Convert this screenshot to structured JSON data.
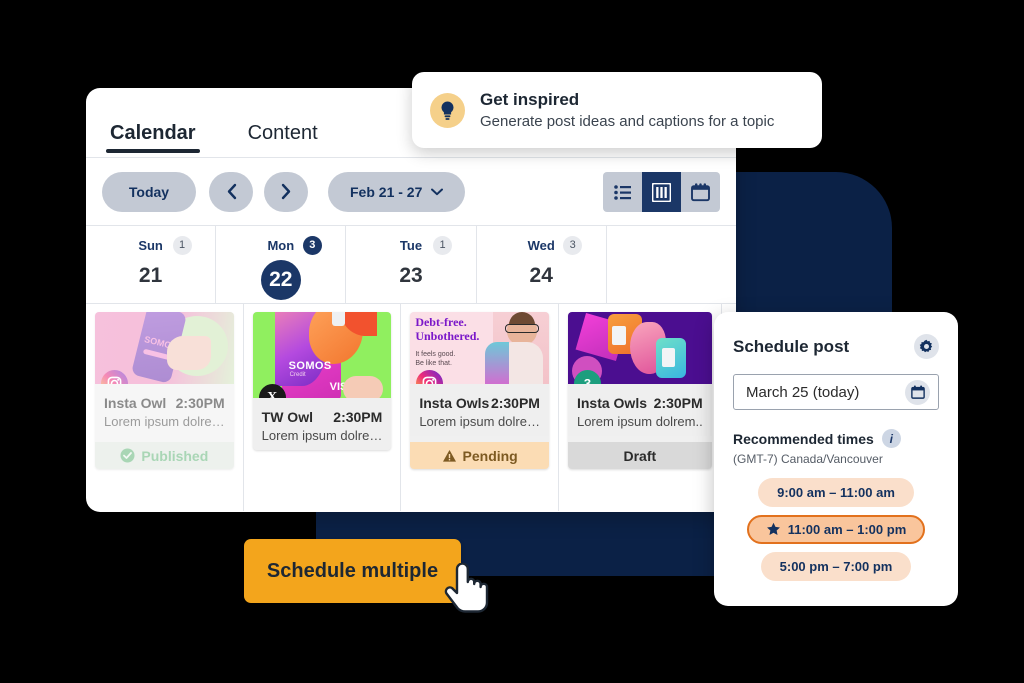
{
  "tabs": [
    {
      "label": "Calendar",
      "active": true
    },
    {
      "label": "Content",
      "active": false
    }
  ],
  "toolbar": {
    "today_label": "Today",
    "prev_icon": "chevron-left-icon",
    "next_icon": "chevron-right-icon",
    "date_range": "Feb 21 - 27",
    "dropdown_icon": "chevron-down-icon",
    "views": [
      {
        "name": "list-view",
        "icon": "list-icon",
        "active": false
      },
      {
        "name": "column-view",
        "icon": "columns-icon",
        "active": true
      },
      {
        "name": "month-view",
        "icon": "calendar-icon",
        "active": false
      }
    ]
  },
  "days": [
    {
      "name": "Sun",
      "number": "21",
      "count": "1",
      "highlight": false,
      "is_today": false
    },
    {
      "name": "Mon",
      "number": "22",
      "count": "3",
      "highlight": true,
      "is_today": true
    },
    {
      "name": "Tue",
      "number": "23",
      "count": "1",
      "highlight": false,
      "is_today": false
    },
    {
      "name": "Wed",
      "number": "24",
      "count": "3",
      "highlight": false,
      "is_today": false
    }
  ],
  "posts": [
    {
      "network": "instagram",
      "network_icon": "instagram-icon",
      "account": "Insta Owl",
      "time": "2:30PM",
      "caption": "Lorem ipsum dolre…",
      "status": "Published",
      "status_icon": "check-circle-icon",
      "status_kind": "published",
      "faded": true
    },
    {
      "network": "x",
      "network_icon": "x-icon",
      "account": "TW Owl",
      "time": "2:30PM",
      "caption": "Lorem ipsum dolre…",
      "status": "",
      "status_icon": "",
      "status_kind": "none",
      "faded": false
    },
    {
      "network": "instagram",
      "network_icon": "instagram-icon",
      "account": "Insta Owls",
      "time": "2:30PM",
      "caption": "Lorem ipsum dolre…",
      "status": "Pending",
      "status_icon": "warning-triangle-icon",
      "status_kind": "pending",
      "faded": false
    },
    {
      "network": "count",
      "network_icon": "post-count-badge",
      "count_value": "3",
      "account": "Insta Owls",
      "time": "2:30PM",
      "caption": "Lorem ipsum dolrem..",
      "status": "Draft",
      "status_icon": "",
      "status_kind": "draft",
      "faded": false
    }
  ],
  "thumbnails": {
    "tue_headline_line1": "Debt-free.",
    "tue_headline_line2": "Unbothered.",
    "tue_sub_line1": "It feels good.",
    "tue_sub_line2": "Be like that.",
    "sun_brand": "SOMOS",
    "mon_brand": "SOMOS",
    "mon_brand_sub": "Credit",
    "mon_card_mark": "VIS"
  },
  "inspire": {
    "icon": "lightbulb-icon",
    "title": "Get inspired",
    "subtitle": "Generate post ideas and captions for a topic"
  },
  "schedule_panel": {
    "title": "Schedule post",
    "settings_icon": "gear-icon",
    "date_value": "March 25 (today)",
    "date_icon": "calendar-icon",
    "recommended_label": "Recommended times",
    "info_icon": "info-icon",
    "timezone": "(GMT-7) Canada/Vancouver",
    "times": [
      {
        "label": "9:00 am – 11:00 am",
        "selected": false,
        "icon": ""
      },
      {
        "label": "11:00 am – 1:00 pm",
        "selected": true,
        "icon": "star-icon"
      },
      {
        "label": "5:00 pm – 7:00 pm",
        "selected": false,
        "icon": ""
      }
    ]
  },
  "cta": {
    "label": "Schedule multiple",
    "cursor_icon": "pointing-hand-cursor"
  },
  "colors": {
    "navy": "#0b2146",
    "navy_accent": "#1b3767",
    "orange": "#f3a51c",
    "orange_border": "#e2711d",
    "peach": "#fadfcb",
    "pill_gray": "#c3c9d4",
    "published_green": "#63b67a",
    "pending_amber": "#7d5a22"
  }
}
